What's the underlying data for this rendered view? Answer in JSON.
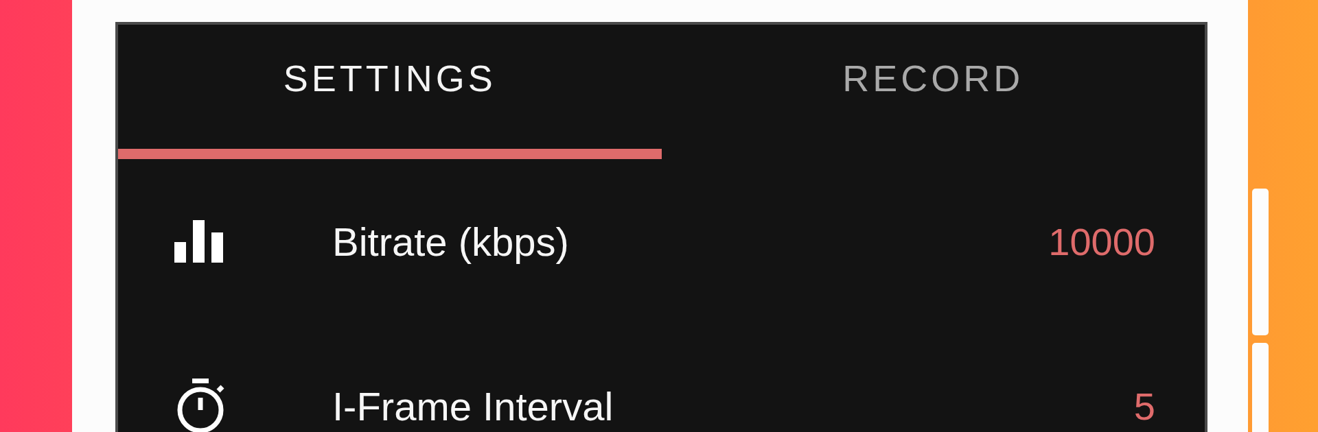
{
  "tabs": [
    {
      "label": "SETTINGS",
      "selected": true
    },
    {
      "label": "RECORD",
      "selected": false
    }
  ],
  "settings": [
    {
      "kind": "bitrate",
      "label": "Bitrate (kbps)",
      "value": "10000"
    },
    {
      "kind": "interval",
      "label": "I-Frame Interval",
      "value": "5"
    }
  ]
}
